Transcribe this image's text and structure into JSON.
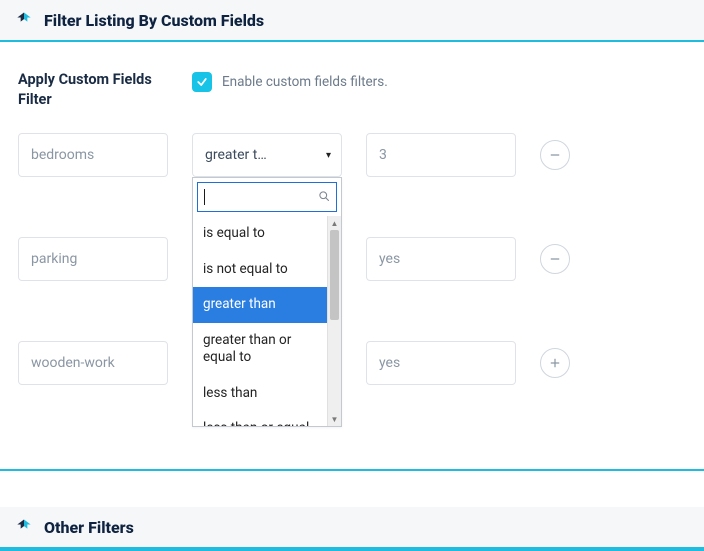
{
  "panel1": {
    "title": "Filter Listing By Custom Fields",
    "side_label": "Apply Custom Fields Filter",
    "enable_label": "Enable custom fields filters."
  },
  "rows": [
    {
      "field": "bedrooms",
      "operator": "greater t…",
      "value": "3",
      "action": "remove"
    },
    {
      "field": "parking",
      "operator": "",
      "value": "yes",
      "action": "remove"
    },
    {
      "field": "wooden-work",
      "operator": "",
      "value": "yes",
      "action": "add"
    }
  ],
  "dropdown": {
    "search_value": "",
    "options": [
      "is equal to",
      "is not equal to",
      "greater than",
      "greater than or equal to",
      "less than",
      "less than or equal"
    ],
    "selected_index": 2
  },
  "panel2": {
    "title": "Other Filters"
  }
}
